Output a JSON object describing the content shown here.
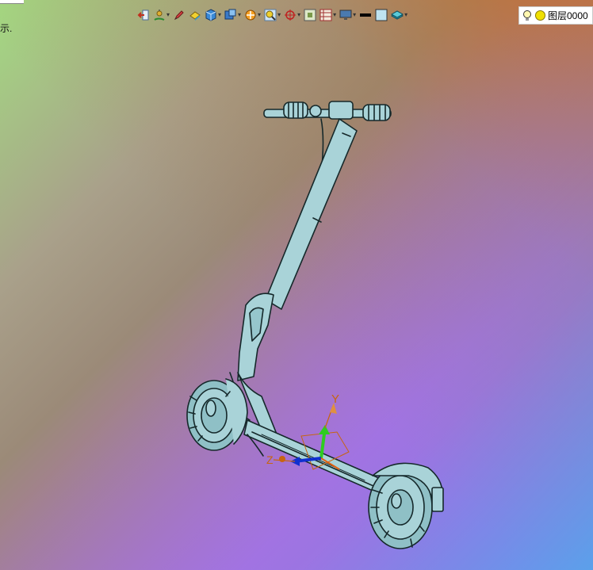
{
  "status": {
    "text": "示."
  },
  "toolbar": {
    "buttons": [
      {
        "name": "exit-sketch-icon",
        "has_menu": false
      },
      {
        "name": "snap-icon",
        "has_menu": true
      },
      {
        "name": "pen-icon",
        "has_menu": false
      },
      {
        "name": "paint-bucket-icon",
        "has_menu": false
      },
      {
        "name": "cube-icon",
        "has_menu": true
      },
      {
        "name": "view-cube-icon",
        "has_menu": true
      },
      {
        "name": "section-icon",
        "has_menu": true
      },
      {
        "name": "zoom-window-icon",
        "has_menu": true
      },
      {
        "name": "origin-icon",
        "has_menu": true
      },
      {
        "name": "frame-icon",
        "has_menu": false
      },
      {
        "name": "grid-icon",
        "has_menu": true
      },
      {
        "name": "monitor-icon",
        "has_menu": true
      },
      {
        "name": "line-style-icon",
        "has_menu": false
      },
      {
        "name": "color-swatch-icon",
        "has_menu": false
      },
      {
        "name": "layers-icon",
        "has_menu": true
      }
    ]
  },
  "layer": {
    "label": "图层0000"
  },
  "triad": {
    "y_label": "Y",
    "z_label": "Z"
  },
  "colors": {
    "model_fill": "#a9d3d8",
    "model_line": "#15282a",
    "axis_y": "#2ecc20",
    "axis_z": "#1030d0",
    "axis_x": "#e06010",
    "triad_label": "#c86410"
  }
}
